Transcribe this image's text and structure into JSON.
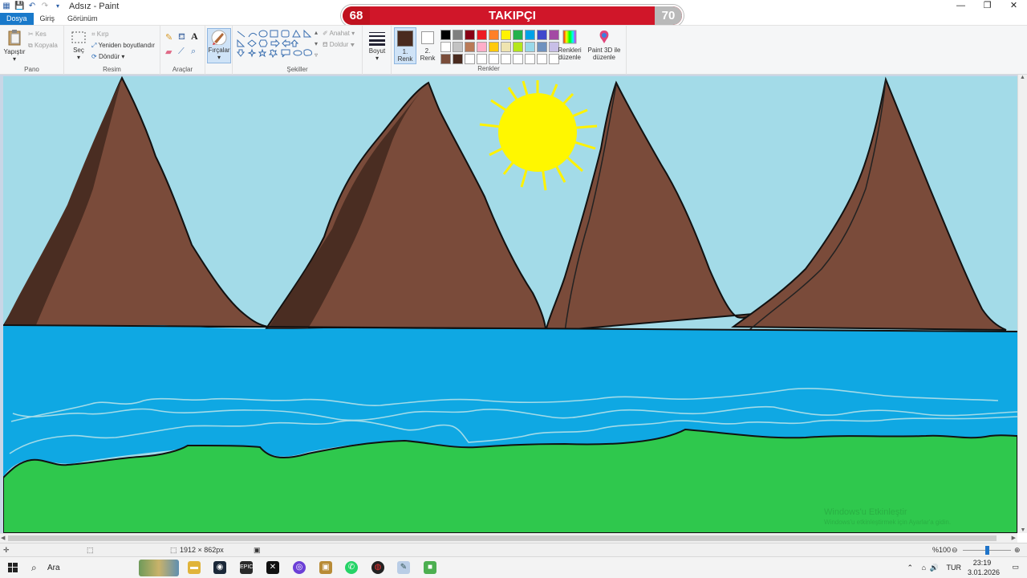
{
  "window": {
    "title": "Adsız - Paint",
    "controls": [
      "—",
      "❐",
      "✕"
    ]
  },
  "overlay": {
    "left_value": "68",
    "label": "TAKIPÇI",
    "right_value": "70"
  },
  "menu": {
    "tabs": [
      "Dosya",
      "Giriş",
      "Görünüm"
    ]
  },
  "ribbon": {
    "pano": {
      "label": "Pano",
      "paste": "Yapıştır",
      "cut": "Kes",
      "copy": "Kopyala"
    },
    "resim": {
      "label": "Resim",
      "select": "Seç",
      "crop": "Kırp",
      "resize": "Yeniden boyutlandır",
      "rotate": "Döndür"
    },
    "araclar": {
      "label": "Araçlar"
    },
    "brushes": {
      "label": "Fırçalar"
    },
    "sekiller": {
      "label": "Şekiller",
      "outline": "Anahat",
      "fill": "Doldur"
    },
    "boyut": {
      "label": "Boyut"
    },
    "color1": {
      "label1": "1.",
      "label2": "Renk",
      "color": "#4a2b1f"
    },
    "color2": {
      "label1": "2.",
      "label2": "Renk",
      "color": "#ffffff"
    },
    "renkler": {
      "label": "Renkler",
      "swatches": [
        "#000000",
        "#7f7f7f",
        "#880015",
        "#ed1c24",
        "#ff7f27",
        "#fff200",
        "#22b14c",
        "#00a2e8",
        "#3f48cc",
        "#a349a4",
        "#ffffff",
        "#c3c3c3",
        "#b97a57",
        "#ffaec9",
        "#ffc90e",
        "#efe4b0",
        "#b5e61d",
        "#99d9ea",
        "#7092be",
        "#c8bfe7",
        "#7a4d3a",
        "#4a2b1f",
        "#ffffff",
        "#ffffff",
        "#ffffff",
        "#ffffff",
        "#ffffff",
        "#ffffff",
        "#ffffff",
        "#ffffff"
      ]
    },
    "edit_colors": {
      "line1": "Renkleri",
      "line2": "düzenle"
    },
    "paint3d": {
      "line1": "Paint 3D ile",
      "line2": "düzenle"
    }
  },
  "status": {
    "size": "1912 × 862px",
    "zoom": "%100"
  },
  "taskbar": {
    "search": "Ara",
    "time": "23:19",
    "date": "3.01.2026",
    "lang": "TUR"
  },
  "watermark": {
    "line1": "Windows'u Etkinleştir",
    "line2": "Windows'u etkinleştirmek için Ayarlar'a gidin."
  },
  "drawing": {
    "sky_color": "#a3dbe8",
    "mountain_color": "#7a4b3a",
    "mountain_shadow": "#4a2d22",
    "water_color": "#0fa8e3",
    "grass_color": "#2fc84d",
    "sun_color": "#fff700"
  }
}
